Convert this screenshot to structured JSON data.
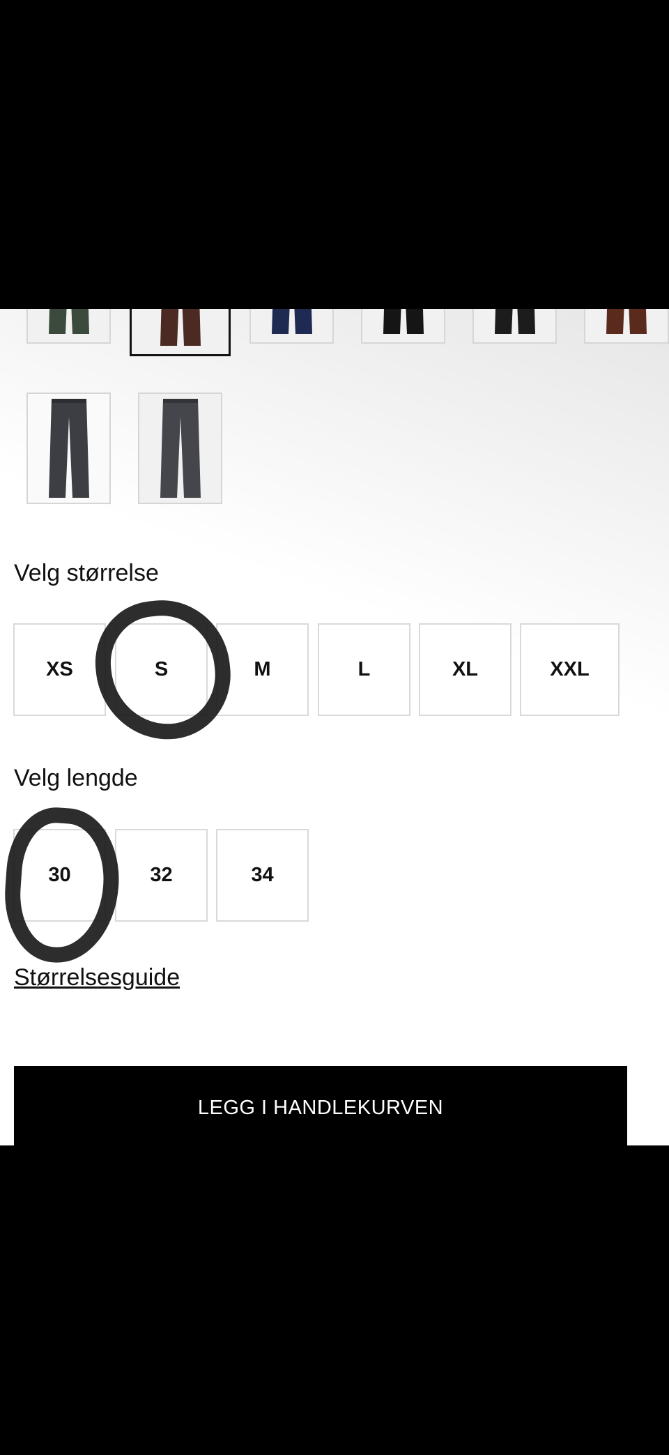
{
  "colors": {
    "variants": [
      "#3b4a3d",
      "#4a2a22",
      "#1f2a52",
      "#151515",
      "#1c1c1c",
      "#5a2a1c",
      "#3c3e44",
      "#44464b"
    ]
  },
  "size_section": {
    "label": "Velg størrelse",
    "options": [
      "XS",
      "S",
      "M",
      "L",
      "XL",
      "XXL"
    ]
  },
  "length_section": {
    "label": "Velg lengde",
    "options": [
      "30",
      "32",
      "34"
    ]
  },
  "size_guide_link": "Størrelsesguide",
  "add_to_cart_label": "LEGG I HANDLEKURVEN"
}
